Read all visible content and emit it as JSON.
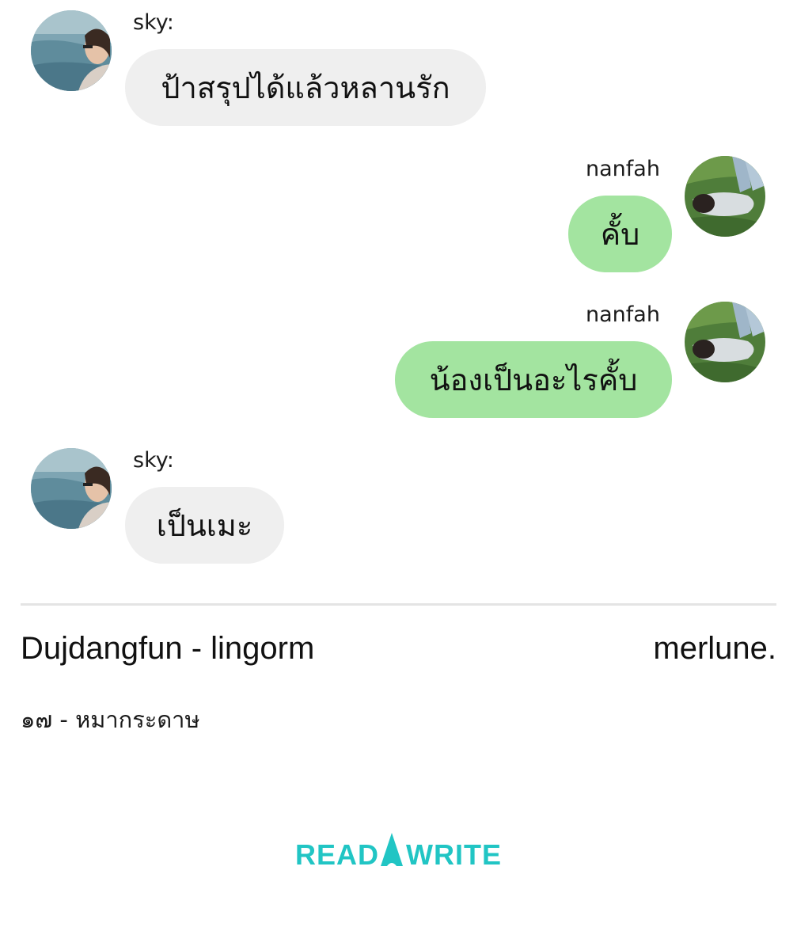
{
  "messages": [
    {
      "side": "left",
      "sender": "sky:",
      "text": "ป้าสรุปได้แล้วหลานรัก"
    },
    {
      "side": "right",
      "sender": "nanfah",
      "text": "คั้บ"
    },
    {
      "side": "right",
      "sender": "nanfah",
      "text": "น้องเป็นอะไรคั้บ"
    },
    {
      "side": "left",
      "sender": "sky:",
      "text": "เป็นเมะ"
    }
  ],
  "footer": {
    "title": "Dujdangfun - lingorm",
    "author": "merlune.",
    "chapter": "๑๗ - หมากระดาษ"
  },
  "brand": {
    "logo_text": "READAWRITE",
    "color": "#21c5c4"
  },
  "colors": {
    "left_bubble": "#efefef",
    "right_bubble": "#a3e4a0"
  }
}
